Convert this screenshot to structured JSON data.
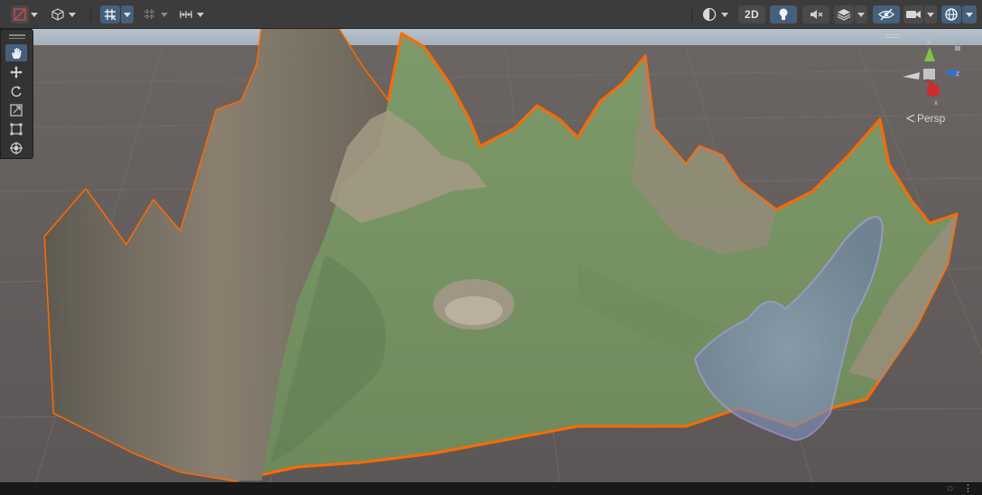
{
  "toolbar": {
    "left": {
      "gizmo_toggle_icon": "draw-mode-icon",
      "shading_icon": "cube-icon",
      "grid_snap_icon": "grid-snap-icon",
      "increment_snap_icon": "increment-snap-icon",
      "align_icon": "ruler-icon"
    },
    "right": {
      "render_mode_icon": "render-mode-icon",
      "mode_2d_label": "2D",
      "lighting_icon": "light-bulb-icon",
      "audio_icon": "audio-mute-icon",
      "effects_icon": "effects-layers-icon",
      "visibility_icon": "hidden-objects-icon",
      "camera_icon": "camera-icon",
      "gizmos_icon": "gizmo-globe-icon"
    }
  },
  "tools": [
    {
      "name": "view-tool",
      "icon": "hand-icon",
      "active": true
    },
    {
      "name": "move-tool",
      "icon": "move-arrows-icon",
      "active": false
    },
    {
      "name": "rotate-tool",
      "icon": "rotate-icon",
      "active": false
    },
    {
      "name": "scale-tool",
      "icon": "scale-icon",
      "active": false
    },
    {
      "name": "rect-tool",
      "icon": "rect-transform-icon",
      "active": false
    },
    {
      "name": "transform-tool",
      "icon": "transform-icon",
      "active": false
    }
  ],
  "orientation_gizmo": {
    "axis_y": "y",
    "axis_z": "z",
    "axis_x": "x",
    "projection_label": "Persp"
  },
  "colors": {
    "accent": "#46607c",
    "selection_outline": "#ff6a00",
    "brush_outline": "#a99ce6",
    "terrain_grass": "#7c9868",
    "terrain_rock": "#8a7d6c",
    "ground": "#6c6564",
    "sky": "#8fa1b0"
  },
  "status": {
    "icons": [
      "layers-icon",
      "more-icon"
    ]
  }
}
